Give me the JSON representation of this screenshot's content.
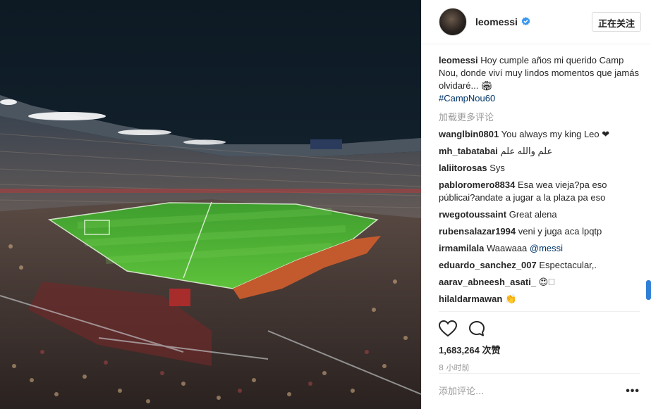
{
  "post": {
    "username": "leomessi",
    "follow_label": "正在关注",
    "caption_user": "leomessi",
    "caption_text": "Hoy cumple años mi querido Camp Nou, donde viví muy lindos momentos que jamás olvidaré... 🏟",
    "hashtag": "#CampNou60",
    "load_more": "加载更多评论",
    "likes": "1,683,264 次赞",
    "time": "8 小时前",
    "comment_placeholder": "添加评论...",
    "options_label": "•••"
  },
  "comments": [
    {
      "user": "wanglbin0801",
      "text": "You always my king Leo ❤"
    },
    {
      "user": "mh_tabatabai",
      "text": "علم والله علم"
    },
    {
      "user": "laliitorosas",
      "text": "Sys"
    },
    {
      "user": "pabloromero8834",
      "text": "Esa wea vieja?pa eso públicai?andate a jugar a la plaza pa eso"
    },
    {
      "user": "rwegotoussaint",
      "text": "Great alena"
    },
    {
      "user": "rubensalazar1994",
      "text": "veni y juga aca lpqtp"
    },
    {
      "user": "irmamilala",
      "text": "Waawaaa",
      "mention": "@messi"
    },
    {
      "user": "eduardo_sanchez_007",
      "text": "Espectacular,."
    },
    {
      "user": "aarav_abneesh_asati_",
      "text": "😍🗆"
    },
    {
      "user": "hilaldarmawan",
      "text": "👏"
    }
  ],
  "icons": [
    "heart-icon",
    "comment-icon",
    "verified-badge-icon",
    "more-options-icon"
  ],
  "colors": {
    "link": "#003569",
    "verified": "#3897f0",
    "muted": "#999999",
    "scroll_thumb": "#2f7fd7"
  }
}
